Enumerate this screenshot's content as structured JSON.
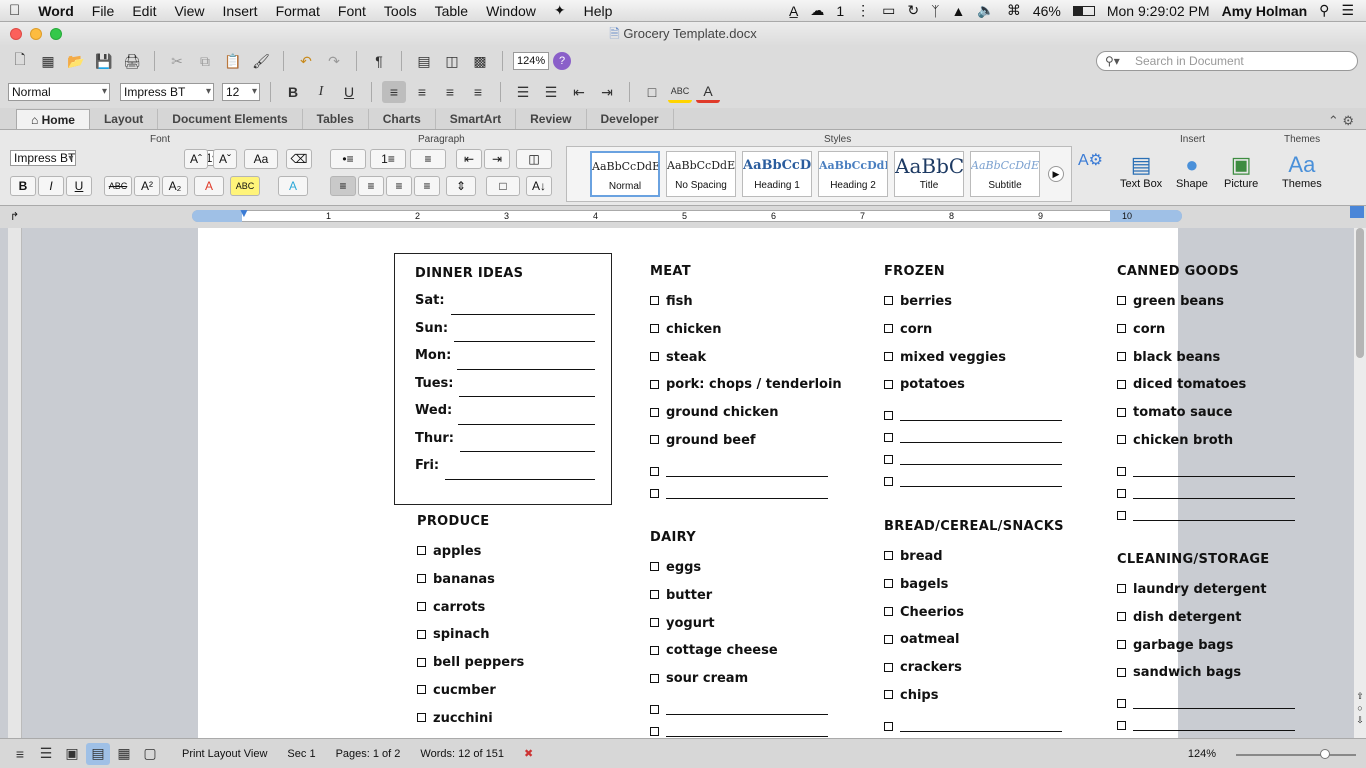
{
  "menubar": {
    "apple": "",
    "app": "Word",
    "items": [
      "File",
      "Edit",
      "View",
      "Insert",
      "Format",
      "Font",
      "Tools",
      "Table",
      "Window",
      "Help"
    ],
    "battery": "46%",
    "clock": "Mon 9:29:02 PM",
    "user": "Amy Holman",
    "notif": "1"
  },
  "window": {
    "title": "Grocery Template.docx"
  },
  "toolbar": {
    "zoom": "124%",
    "search_placeholder": "Search in Document"
  },
  "format": {
    "style": "Normal",
    "font": "Impress BT",
    "size": "12"
  },
  "tabs": [
    "Home",
    "Layout",
    "Document Elements",
    "Tables",
    "Charts",
    "SmartArt",
    "Review",
    "Developer"
  ],
  "ribbon": {
    "groups": {
      "font": "Font",
      "paragraph": "Paragraph",
      "styles": "Styles",
      "insert": "Insert",
      "themes": "Themes"
    },
    "font_name": "Impress BT",
    "font_size": "12",
    "styles": [
      {
        "preview": "AaBbCcDdEe",
        "name": "Normal"
      },
      {
        "preview": "AaBbCcDdEe",
        "name": "No Spacing"
      },
      {
        "preview": "AaBbCcDc",
        "name": "Heading 1"
      },
      {
        "preview": "AaBbCcDdEe",
        "name": "Heading 2"
      },
      {
        "preview": "AaBbC",
        "name": "Title"
      },
      {
        "preview": "AaBbCcDdEe",
        "name": "Subtitle"
      }
    ],
    "insert": [
      "Text Box",
      "Shape",
      "Picture"
    ],
    "themes": "Themes"
  },
  "ruler": [
    "1",
    "2",
    "3",
    "4",
    "5",
    "6",
    "7",
    "8",
    "9",
    "10"
  ],
  "doc": {
    "dinner": {
      "title": "DINNER IDEAS",
      "days": [
        "Sat:",
        "Sun:",
        "Mon:",
        "Tues:",
        "Wed:",
        "Thur:",
        "Fri:"
      ]
    },
    "produce": {
      "title": "PRODUCE",
      "items": [
        "apples",
        "bananas",
        "carrots",
        "spinach",
        "bell peppers",
        "cucmber",
        "zucchini"
      ]
    },
    "meat": {
      "title": "MEAT",
      "items": [
        "fish",
        "chicken",
        "steak",
        "pork: chops / tenderloin",
        "ground chicken",
        "ground beef"
      ]
    },
    "dairy": {
      "title": "DAIRY",
      "items": [
        "eggs",
        "butter",
        "yogurt",
        "cottage cheese",
        "sour cream"
      ]
    },
    "frozen": {
      "title": "FROZEN",
      "items": [
        "berries",
        "corn",
        "mixed veggies",
        "potatoes"
      ]
    },
    "bread": {
      "title": "BREAD/CEREAL/SNACKS",
      "items": [
        "bread",
        "bagels",
        "Cheerios",
        "oatmeal",
        "crackers",
        "chips"
      ]
    },
    "canned": {
      "title": "CANNED GOODS",
      "items": [
        "green beans",
        "corn",
        "black beans",
        "diced tomatoes",
        "tomato sauce",
        "chicken broth"
      ]
    },
    "cleaning": {
      "title": "CLEANING/STORAGE",
      "items": [
        "laundry detergent",
        "dish detergent",
        "garbage bags",
        "sandwich bags"
      ]
    }
  },
  "status": {
    "view": "Print Layout View",
    "sec_label": "Sec",
    "sec": "1",
    "pages_label": "Pages:",
    "pages": "1 of 2",
    "words_label": "Words:",
    "words": "12 of 151",
    "zoom": "124%"
  }
}
